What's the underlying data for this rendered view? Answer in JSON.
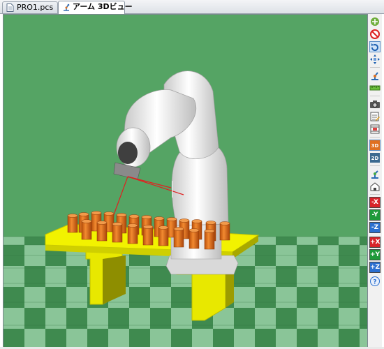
{
  "tabs": [
    {
      "label": "PRO1.pcs",
      "icon": "document-icon"
    },
    {
      "label": "アーム 3Dビュー",
      "icon": "robot-view-icon"
    }
  ],
  "viewport": {
    "background_color": "#55a464",
    "floor_colors": [
      "#3f8a4f",
      "#8ac598"
    ],
    "table_color": "#f0f000",
    "part_color": "#e06a10",
    "robot_color": "#f2f2f2"
  },
  "toolbar": {
    "buttons": [
      {
        "name": "pan-icon"
      },
      {
        "name": "no-entry-icon"
      },
      {
        "name": "rotate-view-icon"
      },
      {
        "name": "move-view-icon"
      },
      {
        "name": "robot-arm-icon"
      },
      {
        "name": "ruler-icon"
      },
      {
        "name": "camera-icon"
      },
      {
        "name": "edit-frame-icon"
      },
      {
        "name": "film-frame-icon"
      },
      {
        "name": "view-3d-icon",
        "label": "3D"
      },
      {
        "name": "view-2d-icon",
        "label": "2D"
      },
      {
        "name": "robot-home-icon"
      },
      {
        "name": "home-icon"
      },
      {
        "name": "minus-x-button",
        "label": "-X"
      },
      {
        "name": "minus-y-button",
        "label": "-Y"
      },
      {
        "name": "minus-z-button",
        "label": "-Z"
      },
      {
        "name": "plus-x-button",
        "label": "+X"
      },
      {
        "name": "plus-y-button",
        "label": "+Y"
      },
      {
        "name": "plus-z-button",
        "label": "+Z"
      },
      {
        "name": "help-icon",
        "label": "?"
      }
    ],
    "axis_colors": {
      "x": "#d8232a",
      "y": "#1e9a3a",
      "z": "#2a6fd0"
    }
  }
}
